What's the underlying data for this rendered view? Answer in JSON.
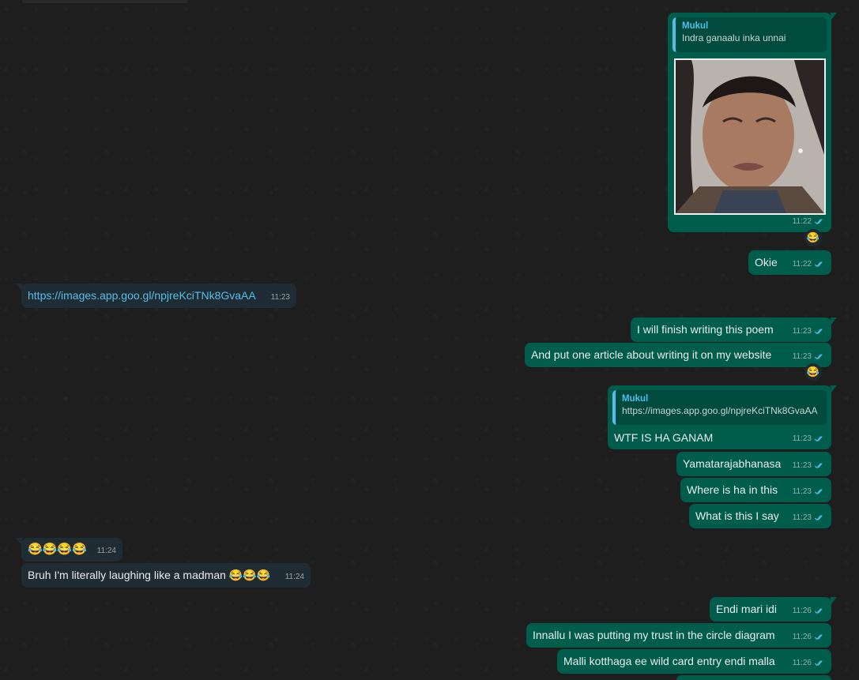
{
  "messages": [
    {
      "id": "m1",
      "dir": "out",
      "type": "image-reply",
      "quote_name": "Mukul",
      "quote_text": "Indra ganaalu inka unnai",
      "time": "11:22",
      "reaction": "😂",
      "image_desc": "crying-woman-photo"
    },
    {
      "id": "m2",
      "dir": "out",
      "text": "Okie",
      "time": "11:22"
    },
    {
      "id": "m3",
      "dir": "in",
      "text": "https://images.app.goo.gl/npjreKciTNk8GvaAA",
      "time": "11:23",
      "is_link": true
    },
    {
      "id": "m4",
      "dir": "out",
      "text": "I will finish writing this poem",
      "time": "11:23"
    },
    {
      "id": "m5",
      "dir": "out",
      "text": "And put one article about writing it on my website",
      "time": "11:23",
      "reaction": "😂"
    },
    {
      "id": "m6",
      "dir": "out",
      "type": "reply",
      "quote_name": "Mukul",
      "quote_text": "https://images.app.goo.gl/npjreKciTNk8GvaAA",
      "text": "WTF IS HA GANAM",
      "time": "11:23"
    },
    {
      "id": "m7",
      "dir": "out",
      "text": "Yamatarajabhanasa",
      "time": "11:23"
    },
    {
      "id": "m8",
      "dir": "out",
      "text": "Where is ha in this",
      "time": "11:23"
    },
    {
      "id": "m9",
      "dir": "out",
      "text": "What is this I say",
      "time": "11:23"
    },
    {
      "id": "m10",
      "dir": "in",
      "text": "😂😂😂😂",
      "time": "11:24"
    },
    {
      "id": "m11",
      "dir": "in",
      "text": "Bruh I'm literally laughing like a madman 😂😂😂",
      "time": "11:24"
    },
    {
      "id": "m12",
      "dir": "out",
      "text": "Endi mari idi",
      "time": "11:26"
    },
    {
      "id": "m13",
      "dir": "out",
      "text": "Innallu I was putting my trust in the circle diagram",
      "time": "11:26"
    },
    {
      "id": "m14",
      "dir": "out",
      "text": "Malli kotthaga ee wild card entry endi malla",
      "time": "11:26"
    }
  ],
  "colors": {
    "outgoing_bubble": "#005c4b",
    "incoming_bubble": "#202c33",
    "link": "#53bdeb",
    "read_ticks": "#53bdeb",
    "background": "#1e1e1e"
  }
}
